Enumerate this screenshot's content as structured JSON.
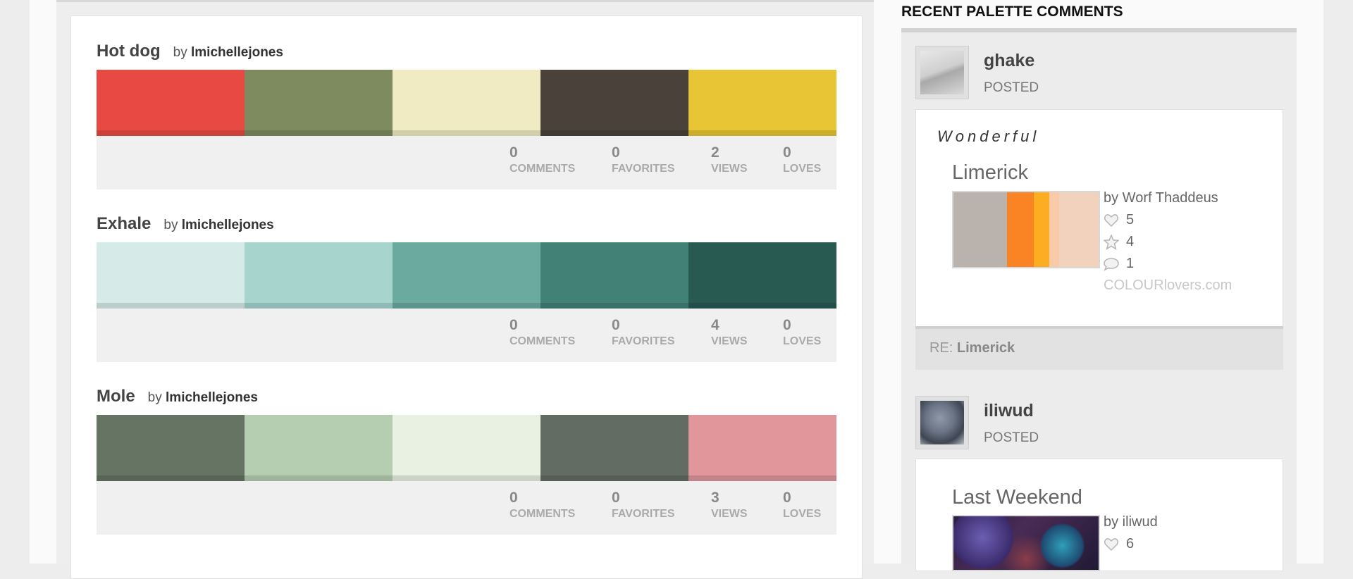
{
  "palettes": [
    {
      "title": "Hot dog",
      "by_prefix": "by",
      "author": "lmichellejones",
      "colors": [
        "#e84a43",
        "#7d8b5e",
        "#f0ebc2",
        "#4a423a",
        "#e8c534"
      ],
      "stats": [
        {
          "value": "0",
          "label": "COMMENTS"
        },
        {
          "value": "0",
          "label": "FAVORITES"
        },
        {
          "value": "2",
          "label": "VIEWS"
        },
        {
          "value": "0",
          "label": "LOVES"
        }
      ]
    },
    {
      "title": "Exhale",
      "by_prefix": "by",
      "author": "lmichellejones",
      "colors": [
        "#d6ebe7",
        "#a7d4cd",
        "#6aaa9f",
        "#418176",
        "#285a52"
      ],
      "stats": [
        {
          "value": "0",
          "label": "COMMENTS"
        },
        {
          "value": "0",
          "label": "FAVORITES"
        },
        {
          "value": "4",
          "label": "VIEWS"
        },
        {
          "value": "0",
          "label": "LOVES"
        }
      ]
    },
    {
      "title": "Mole",
      "by_prefix": "by",
      "author": "lmichellejones",
      "colors": [
        "#657463",
        "#b5cdb1",
        "#e8f1e2",
        "#636c63",
        "#e0969b"
      ],
      "stats": [
        {
          "value": "0",
          "label": "COMMENTS"
        },
        {
          "value": "0",
          "label": "FAVORITES"
        },
        {
          "value": "3",
          "label": "VIEWS"
        },
        {
          "value": "0",
          "label": "LOVES"
        }
      ]
    }
  ],
  "sidebar": {
    "title": "RECENT PALETTE COMMENTS",
    "comments": [
      {
        "user": "ghake",
        "action": "POSTED",
        "avatar_icon": "user-avatar-icon",
        "text": "Wonderful",
        "ref_title": "Limerick",
        "ref_by": "by Worf Thaddeus",
        "ref_loves": "5",
        "ref_favorites": "4",
        "ref_comments": "1",
        "ref_brand": "COLOURlovers.com",
        "ref_colors": [
          "#b9b2ad",
          "#fa8324",
          "#fcad22",
          "#f8caa8",
          "#f3d2bd"
        ],
        "re_prefix": "RE:",
        "re_title": "Limerick"
      },
      {
        "user": "iliwud",
        "action": "POSTED",
        "avatar_icon": "user-avatar-icon",
        "ref_title": "Last Weekend",
        "ref_by": "by iliwud",
        "ref_loves": "6"
      }
    ]
  }
}
